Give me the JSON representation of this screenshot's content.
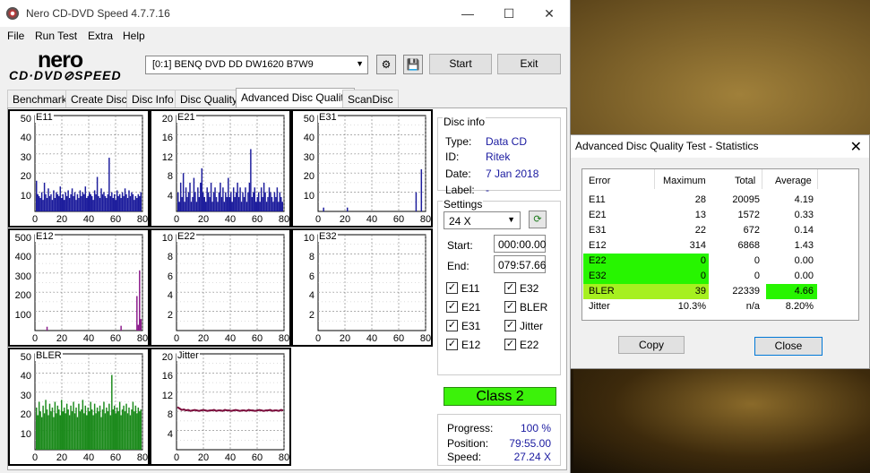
{
  "main": {
    "title": "Nero CD-DVD Speed 4.7.7.16",
    "minimize": "—",
    "maximize": "☐",
    "close": "✕"
  },
  "menus": [
    "File",
    "Run Test",
    "Extra",
    "Help"
  ],
  "logo": {
    "top": "nero",
    "bottom": "CD·DVD⊘SPEED"
  },
  "toolbar": {
    "drive": "[0:1]   BENQ DVD DD DW1620 B7W9",
    "start": "Start",
    "exit": "Exit"
  },
  "tabs": [
    "Benchmark",
    "Create Disc",
    "Disc Info",
    "Disc Quality",
    "Advanced Disc Quality",
    "ScanDisc"
  ],
  "active_tab": "Advanced Disc Quality",
  "disc_info": {
    "title": "Disc info",
    "labels": [
      "Type:",
      "ID:",
      "Date:",
      "Label:"
    ],
    "values": [
      "Data CD",
      "Ritek",
      "7 Jan 2018",
      "-"
    ]
  },
  "settings": {
    "title": "Settings",
    "speed": "24 X",
    "start_label": "Start:",
    "start": "000:00.00",
    "end_label": "End:",
    "end": "079:57.66"
  },
  "checks": [
    {
      "label": "E11",
      "checked": true
    },
    {
      "label": "E32",
      "checked": true
    },
    {
      "label": "E21",
      "checked": true
    },
    {
      "label": "BLER",
      "checked": true
    },
    {
      "label": "E31",
      "checked": true
    },
    {
      "label": "Jitter",
      "checked": true
    },
    {
      "label": "E12",
      "checked": true
    },
    {
      "label": "E22",
      "checked": true
    }
  ],
  "class_label": "Class 2",
  "progress": {
    "labels": [
      "Progress:",
      "Position:",
      "Speed:"
    ],
    "values": [
      "100 %",
      "79:55.00",
      "27.24 X"
    ]
  },
  "chart_data": [
    {
      "name": "E11",
      "type": "bar",
      "yticks": [
        "50",
        "40",
        "30",
        "20",
        "10"
      ],
      "ylim": [
        0,
        50
      ],
      "xticks": [
        "0",
        "20",
        "40",
        "60",
        "80"
      ],
      "xlim": [
        0,
        80
      ],
      "color": "#1c1c9c",
      "values": [
        16,
        9,
        8,
        7,
        10,
        6,
        15,
        9,
        7,
        12,
        8,
        9,
        6,
        11,
        7,
        10,
        9,
        8,
        13,
        7,
        9,
        6,
        10,
        8,
        11,
        7,
        9,
        12,
        8,
        10,
        6,
        9,
        7,
        11,
        8,
        10,
        9,
        13,
        7,
        8,
        10,
        9,
        8,
        6,
        11,
        9,
        18,
        8,
        7,
        12,
        9,
        10,
        8,
        7,
        9,
        28,
        8,
        10,
        7,
        9,
        6,
        11,
        8,
        9,
        7,
        10,
        8,
        12,
        9,
        7,
        11,
        8,
        10,
        9,
        6,
        8,
        7,
        9,
        8,
        10
      ]
    },
    {
      "name": "E21",
      "type": "bar",
      "yticks": [
        "20",
        "16",
        "12",
        "8",
        "4"
      ],
      "ylim": [
        0,
        20
      ],
      "xticks": [
        "0",
        "20",
        "40",
        "60",
        "80"
      ],
      "xlim": [
        0,
        80
      ],
      "color": "#1c1c9c",
      "values": [
        4,
        2,
        6,
        3,
        8,
        2,
        5,
        3,
        4,
        6,
        2,
        3,
        7,
        4,
        2,
        5,
        3,
        6,
        9,
        4,
        3,
        2,
        5,
        4,
        3,
        6,
        2,
        4,
        5,
        3,
        2,
        4,
        6,
        3,
        5,
        2,
        4,
        3,
        7,
        3,
        4,
        2,
        5,
        3,
        4,
        6,
        3,
        5,
        2,
        4,
        3,
        5,
        2,
        4,
        6,
        13,
        3,
        4,
        5,
        2,
        3,
        4,
        2,
        5,
        3,
        6,
        4,
        2,
        3,
        5,
        4,
        3,
        2,
        4,
        3,
        5,
        2,
        4,
        3,
        2
      ]
    },
    {
      "name": "E31",
      "type": "bar",
      "yticks": [
        "50",
        "40",
        "30",
        "20",
        "10"
      ],
      "ylim": [
        0,
        50
      ],
      "xticks": [
        "0",
        "20",
        "40",
        "60",
        "80"
      ],
      "xlim": [
        0,
        80
      ],
      "color": "#1c1c9c",
      "values": [
        0,
        0,
        0,
        2,
        0,
        0,
        0,
        0,
        0,
        0,
        0,
        0,
        0,
        0,
        0,
        0,
        0,
        0,
        0,
        0,
        0,
        2,
        0,
        0,
        0,
        0,
        0,
        0,
        0,
        0,
        0,
        0,
        0,
        0,
        0,
        0,
        0,
        0,
        0,
        0,
        0,
        0,
        0,
        0,
        0,
        0,
        0,
        0,
        0,
        0,
        0,
        0,
        0,
        0,
        0,
        0,
        0,
        0,
        0,
        0,
        0,
        0,
        0,
        0,
        0,
        0,
        0,
        0,
        0,
        0,
        0,
        0,
        0,
        10,
        0,
        0,
        0,
        22,
        0,
        0
      ]
    },
    {
      "name": "E12",
      "type": "bar",
      "yticks": [
        "500",
        "400",
        "300",
        "200",
        "100"
      ],
      "ylim": [
        0,
        500
      ],
      "xticks": [
        "0",
        "20",
        "40",
        "60",
        "80"
      ],
      "xlim": [
        0,
        80
      ],
      "color": "#8a1a8a",
      "values": [
        0,
        0,
        0,
        0,
        0,
        0,
        0,
        0,
        20,
        0,
        0,
        0,
        0,
        0,
        0,
        0,
        0,
        0,
        0,
        0,
        0,
        0,
        0,
        0,
        0,
        0,
        0,
        0,
        0,
        0,
        0,
        0,
        0,
        0,
        0,
        0,
        0,
        0,
        0,
        0,
        0,
        0,
        0,
        0,
        0,
        0,
        0,
        0,
        0,
        0,
        0,
        0,
        0,
        0,
        0,
        0,
        0,
        0,
        0,
        0,
        0,
        0,
        0,
        0,
        25,
        0,
        0,
        0,
        0,
        0,
        0,
        0,
        0,
        0,
        0,
        0,
        180,
        30,
        314,
        60
      ]
    },
    {
      "name": "E22",
      "type": "bar",
      "yticks": [
        "10",
        "8",
        "6",
        "4",
        "2"
      ],
      "ylim": [
        0,
        10
      ],
      "xticks": [
        "0",
        "20",
        "40",
        "60",
        "80"
      ],
      "xlim": [
        0,
        80
      ],
      "color": "#1c1c9c",
      "values": []
    },
    {
      "name": "E32",
      "type": "bar",
      "yticks": [
        "10",
        "8",
        "6",
        "4",
        "2"
      ],
      "ylim": [
        0,
        10
      ],
      "xticks": [
        "0",
        "20",
        "40",
        "60",
        "80"
      ],
      "xlim": [
        0,
        80
      ],
      "color": "#1c1c9c",
      "values": []
    },
    {
      "name": "BLER",
      "type": "bar",
      "yticks": [
        "50",
        "40",
        "30",
        "20",
        "10"
      ],
      "ylim": [
        0,
        50
      ],
      "xticks": [
        "0",
        "20",
        "40",
        "60",
        "80"
      ],
      "xlim": [
        0,
        80
      ],
      "color": "#1b8a1b",
      "values": [
        22,
        18,
        25,
        20,
        17,
        23,
        19,
        26,
        21,
        18,
        24,
        20,
        22,
        17,
        25,
        19,
        23,
        21,
        18,
        26,
        20,
        22,
        19,
        24,
        21,
        18,
        23,
        20,
        25,
        19,
        22,
        17,
        24,
        20,
        21,
        26,
        19,
        23,
        18,
        22,
        20,
        25,
        21,
        18,
        24,
        19,
        22,
        20,
        23,
        17,
        21,
        25,
        19,
        22,
        20,
        24,
        18,
        39,
        21,
        23,
        19,
        22,
        20,
        25,
        18,
        21,
        23,
        20,
        24,
        19,
        22,
        18,
        21,
        25,
        20,
        23,
        19,
        22,
        20,
        21
      ]
    },
    {
      "name": "Jitter",
      "type": "line",
      "yticks": [
        "20",
        "16",
        "12",
        "8",
        "4"
      ],
      "ylim": [
        0,
        20
      ],
      "xticks": [
        "0",
        "20",
        "40",
        "60",
        "80"
      ],
      "xlim": [
        0,
        80
      ],
      "color": "#7a0a3a",
      "values": [
        8.9,
        8.6,
        8.3,
        8.4,
        8.2,
        8.3,
        8.1,
        8.2,
        8.3,
        8.2,
        8.1,
        8.2,
        8.3,
        8.2,
        8.1,
        8.2,
        8.2,
        8.3,
        8.1,
        8.2,
        8.2,
        8.1,
        8.3,
        8.2,
        8.2,
        8.1,
        8.2,
        8.3,
        8.2,
        8.1,
        8.2,
        8.2,
        8.1,
        8.3,
        8.2,
        8.2,
        8.1,
        8.2,
        8.3,
        8.2,
        8.1,
        8.2,
        8.2,
        8.3,
        8.1,
        8.2,
        8.2,
        8.1,
        8.3,
        8.2
      ]
    }
  ],
  "dialog": {
    "title": "Advanced Disc Quality Test - Statistics",
    "close_icon": "✕",
    "headers": [
      "Error",
      "Maximum",
      "Total",
      "Average"
    ],
    "rows": [
      [
        "E11",
        "28",
        "20095",
        "4.19"
      ],
      [
        "E21",
        "13",
        "1572",
        "0.33"
      ],
      [
        "E31",
        "22",
        "672",
        "0.14"
      ],
      [
        "E12",
        "314",
        "6868",
        "1.43"
      ],
      [
        "E22",
        "0",
        "0",
        "0.00"
      ],
      [
        "E32",
        "0",
        "0",
        "0.00"
      ],
      [
        "BLER",
        "39",
        "22339",
        "4.66"
      ],
      [
        "Jitter",
        "10.3%",
        "n/a",
        "8.20%"
      ]
    ],
    "copy": "Copy",
    "close": "Close",
    "highlight_green": "#27f500",
    "highlight_lime": "#a6f020"
  }
}
